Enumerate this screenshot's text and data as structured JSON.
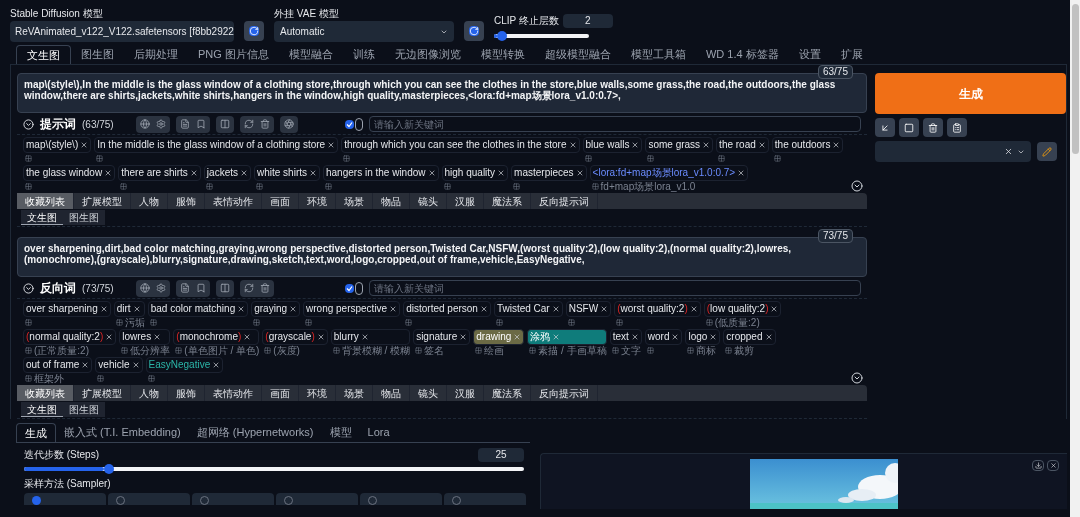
{
  "model_bar": {
    "sd_model": {
      "label": "Stable Diffusion 模型",
      "value": "ReVAnimated_v122_V122.safetensors [f8bb2922"
    },
    "vae": {
      "label": "外挂 VAE 模型",
      "value": "Automatic"
    },
    "clip": {
      "label": "CLIP 终止层数",
      "value": "2",
      "level": 0.08
    }
  },
  "tabs": [
    {
      "label": "文生图",
      "selected": true
    },
    {
      "label": "图生图",
      "selected": false
    },
    {
      "label": "后期处理",
      "selected": false
    },
    {
      "label": "PNG 图片信息",
      "selected": false
    },
    {
      "label": "模型融合",
      "selected": false
    },
    {
      "label": "训练",
      "selected": false
    },
    {
      "label": "无边图像浏览",
      "selected": false
    },
    {
      "label": "模型转换",
      "selected": false
    },
    {
      "label": "超级模型融合",
      "selected": false
    },
    {
      "label": "模型工具箱",
      "selected": false
    },
    {
      "label": "WD 1.4 标签器",
      "selected": false
    },
    {
      "label": "设置",
      "selected": false
    },
    {
      "label": "扩展",
      "selected": false
    }
  ],
  "prompt": {
    "text": "map\\(style\\),In the middle is the glass window of a clothing store,through which you can see the clothes in the store,blue walls,some grass,the road,the outdoors,the glass window,there are shirts,jackets,white shirts,hangers in the window,high quality,masterpieces,<lora:fd+map场景lora_v1.0:0.7>,",
    "counter": "63/75",
    "title": "提示词",
    "count": "(63/75)",
    "checked": true,
    "placeholder": "请输入新关键词",
    "tags": [
      {
        "label": "map\\(style\\)",
        "kind": "plain"
      },
      {
        "label": "In the middle is the glass window of a clothing store",
        "kind": "plain"
      },
      {
        "label": "through which you can see the clothes in the store",
        "kind": "plain"
      },
      {
        "label": "blue walls",
        "kind": "plain"
      },
      {
        "label": "some grass",
        "kind": "plain"
      },
      {
        "label": "the road",
        "kind": "plain"
      },
      {
        "label": "the outdoors",
        "kind": "plain"
      },
      {
        "label": "the glass window",
        "kind": "plain"
      },
      {
        "label": "there are shirts",
        "kind": "plain"
      },
      {
        "label": "jackets",
        "kind": "plain"
      },
      {
        "label": "white shirts",
        "kind": "plain"
      },
      {
        "label": "hangers in the window",
        "kind": "plain"
      },
      {
        "label": "high quality",
        "kind": "plain"
      },
      {
        "label": "masterpieces",
        "kind": "plain"
      },
      {
        "label": "<lora:fd+map场景lora_v1.0:0.7>",
        "kind": "lora",
        "note": "fd+map场景lora_v1.0"
      }
    ],
    "categories": [
      {
        "label": "收藏列表",
        "selected": true
      },
      {
        "label": "扩展模型",
        "selected": false
      },
      {
        "label": "人物",
        "selected": false
      },
      {
        "label": "服饰",
        "selected": false
      },
      {
        "label": "表情动作",
        "selected": false
      },
      {
        "label": "画面",
        "selected": false
      },
      {
        "label": "环境",
        "selected": false
      },
      {
        "label": "场景",
        "selected": false
      },
      {
        "label": "物品",
        "selected": false
      },
      {
        "label": "镜头",
        "selected": false
      },
      {
        "label": "汉服",
        "selected": false
      },
      {
        "label": "魔法系",
        "selected": false
      },
      {
        "label": "反向提示词",
        "selected": false
      }
    ],
    "subtabs": [
      {
        "label": "文生图",
        "selected": true
      },
      {
        "label": "图生图",
        "selected": false
      }
    ]
  },
  "negative": {
    "text": "over sharpening,dirt,bad color matching,graying,wrong perspective,distorted person,Twisted Car,NSFW,(worst quality:2),(low quality:2),(normal quality:2),lowres,(monochrome),(grayscale),blurry,signature,drawing,sketch,text,word,logo,cropped,out of frame,vehicle,EasyNegative,",
    "counter": "73/75",
    "title": "反向词",
    "count": "(73/75)",
    "checked": true,
    "placeholder": "请输入新关键词",
    "tags": [
      {
        "label": "over sharpening",
        "kind": "plain"
      },
      {
        "label": "dirt",
        "kind": "plain",
        "note": "污垢"
      },
      {
        "label": "bad color matching",
        "kind": "plain"
      },
      {
        "label": "graying",
        "kind": "plain"
      },
      {
        "label": "wrong perspective",
        "kind": "plain"
      },
      {
        "label": "distorted person",
        "kind": "plain"
      },
      {
        "label": "Twisted Car",
        "kind": "plain"
      },
      {
        "label": "NSFW",
        "kind": "plain"
      },
      {
        "label": "worst quality:2",
        "kind": "plain",
        "prefix": "(",
        "suffix": ")"
      },
      {
        "label": "low quality:2",
        "kind": "plain",
        "prefix": "(",
        "suffix": ")",
        "note": "(低质量:2)"
      },
      {
        "label": "normal quality:2",
        "kind": "plain",
        "prefix": "(",
        "suffix": ")",
        "note": "(正常质量:2)"
      },
      {
        "label": "lowres",
        "kind": "plain",
        "note": "低分辨率"
      },
      {
        "label": "monochrome",
        "kind": "plain",
        "prefix": "(",
        "suffix": ")",
        "note": "(单色图片 / 单色)"
      },
      {
        "label": "grayscale",
        "kind": "plain",
        "prefix": "(",
        "suffix": ")",
        "note": "(灰度)"
      },
      {
        "label": "blurry",
        "kind": "plain",
        "note": "背景模糊 / 模糊"
      },
      {
        "label": "signature",
        "kind": "plain",
        "note": "签名"
      },
      {
        "label": "drawing",
        "kind": "marked",
        "color": "#6b6a45",
        "note": "绘画"
      },
      {
        "label": "涂鸦",
        "kind": "marked",
        "color": "#0f7c7b",
        "note": "素描 / 手画草稿"
      },
      {
        "label": "text",
        "kind": "plain",
        "note": "文字"
      },
      {
        "label": "word",
        "kind": "plain"
      },
      {
        "label": "logo",
        "kind": "plain",
        "note": "商标"
      },
      {
        "label": "cropped",
        "kind": "plain",
        "note": "裁剪"
      },
      {
        "label": "out of frame",
        "kind": "plain",
        "note": "框架外"
      },
      {
        "label": "vehicle",
        "kind": "plain"
      },
      {
        "label": "EasyNegative",
        "kind": "embedding"
      }
    ],
    "categories": [
      {
        "label": "收藏列表",
        "selected": true
      },
      {
        "label": "扩展模型",
        "selected": false
      },
      {
        "label": "人物",
        "selected": false
      },
      {
        "label": "服饰",
        "selected": false
      },
      {
        "label": "表情动作",
        "selected": false
      },
      {
        "label": "画面",
        "selected": false
      },
      {
        "label": "环境",
        "selected": false
      },
      {
        "label": "场景",
        "selected": false
      },
      {
        "label": "物品",
        "selected": false
      },
      {
        "label": "镜头",
        "selected": false
      },
      {
        "label": "汉服",
        "selected": false
      },
      {
        "label": "魔法系",
        "selected": false
      },
      {
        "label": "反向提示词",
        "selected": false
      }
    ],
    "subtabs": [
      {
        "label": "文生图",
        "selected": true
      },
      {
        "label": "图生图",
        "selected": false
      }
    ]
  },
  "side": {
    "generate": "生成"
  },
  "bottom_tabs": [
    {
      "label": "生成",
      "selected": true
    },
    {
      "label": "嵌入式 (T.I. Embedding)",
      "selected": false
    },
    {
      "label": "超网络 (Hypernetworks)",
      "selected": false
    },
    {
      "label": "模型",
      "selected": false
    },
    {
      "label": "Lora",
      "selected": false
    }
  ],
  "steps": {
    "label": "迭代步数 (Steps)",
    "value": "25",
    "level": 0.17
  },
  "sampler": {
    "label": "采样方法 (Sampler)",
    "options": [
      {
        "selected": true
      },
      {
        "selected": false
      },
      {
        "selected": false
      },
      {
        "selected": false
      },
      {
        "selected": false
      },
      {
        "selected": false
      }
    ]
  }
}
